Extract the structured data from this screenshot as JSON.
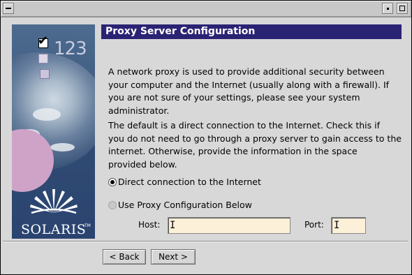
{
  "header": {
    "title": "Proxy Server Configuration"
  },
  "sidebar": {
    "brand": "SOLARIS",
    "trademark": "TM",
    "art_text": "123"
  },
  "content": {
    "paragraph1": "A network proxy is used to provide additional security between\nyour computer and the Internet (usually along with a firewall). If\nyou are not sure of your settings, please see your system\nadministrator.",
    "paragraph2": "The default is a direct connection to the Internet. Check this if\nyou do not need to go through a proxy server to gain access to the\ninternet.  Otherwise, provide the information in the space\nprovided below."
  },
  "options": {
    "direct": {
      "label": "Direct connection to the Internet",
      "selected": true
    },
    "proxy": {
      "label": "Use Proxy Configuration Below",
      "selected": false
    }
  },
  "fields": {
    "host": {
      "label": "Host:",
      "value": ""
    },
    "port": {
      "label": "Port:",
      "value": ""
    }
  },
  "buttons": {
    "back": "< Back",
    "next": "Next >"
  },
  "colors": {
    "header_bg": "#2a2374",
    "input_bg": "#fdf0d8",
    "window_bg": "#d8d8d8"
  }
}
